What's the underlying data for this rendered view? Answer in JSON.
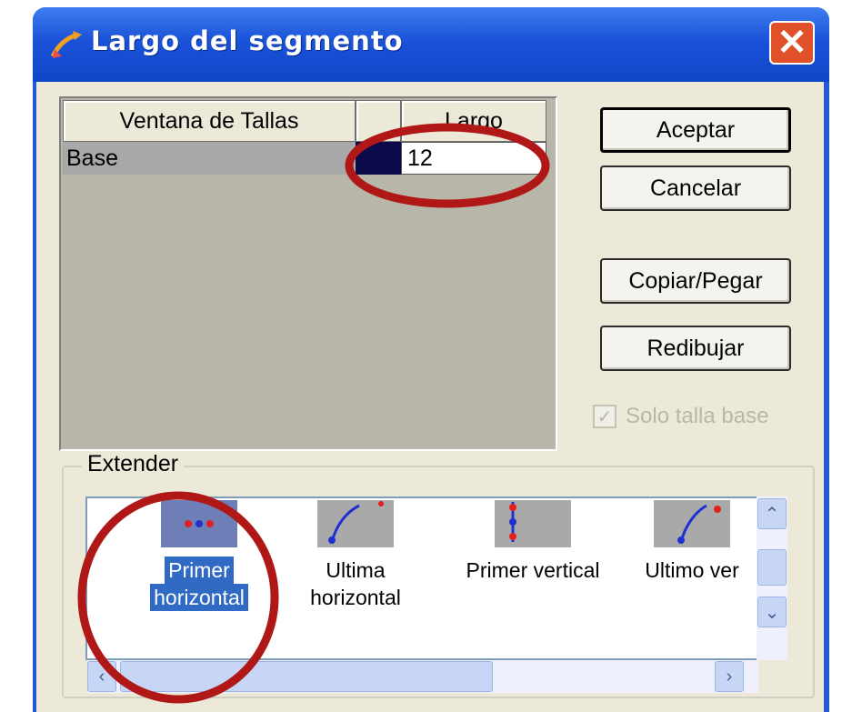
{
  "window": {
    "title": "Largo del segmento",
    "close_glyph": "✕"
  },
  "grid": {
    "columns": [
      "Ventana de Tallas",
      "",
      "Largo"
    ],
    "rows": [
      {
        "name": "Base",
        "color": "#0a0a4a",
        "value": "12"
      }
    ]
  },
  "buttons": {
    "accept": "Aceptar",
    "cancel": "Cancelar",
    "copy_paste": "Copiar/Pegar",
    "redraw": "Redibujar"
  },
  "checkbox": {
    "label": "Solo talla base",
    "checked": true,
    "enabled": false
  },
  "extender": {
    "label": "Extender",
    "items": [
      {
        "line1": "Primer",
        "line2": "horizontal",
        "selected": true,
        "icon": "primer-horizontal-icon"
      },
      {
        "line1": "Ultima",
        "line2": "horizontal",
        "selected": false,
        "icon": "ultima-horizontal-icon"
      },
      {
        "line1": "Primer vertical",
        "line2": "",
        "selected": false,
        "icon": "primer-vertical-icon"
      },
      {
        "line1": "Ultimo ver",
        "line2": "",
        "selected": false,
        "icon": "ultimo-vertical-icon"
      }
    ]
  },
  "scroll_glyphs": {
    "up": "⌃",
    "down": "⌄",
    "left": "‹",
    "right": "›"
  },
  "annotation_color": "#b01818"
}
